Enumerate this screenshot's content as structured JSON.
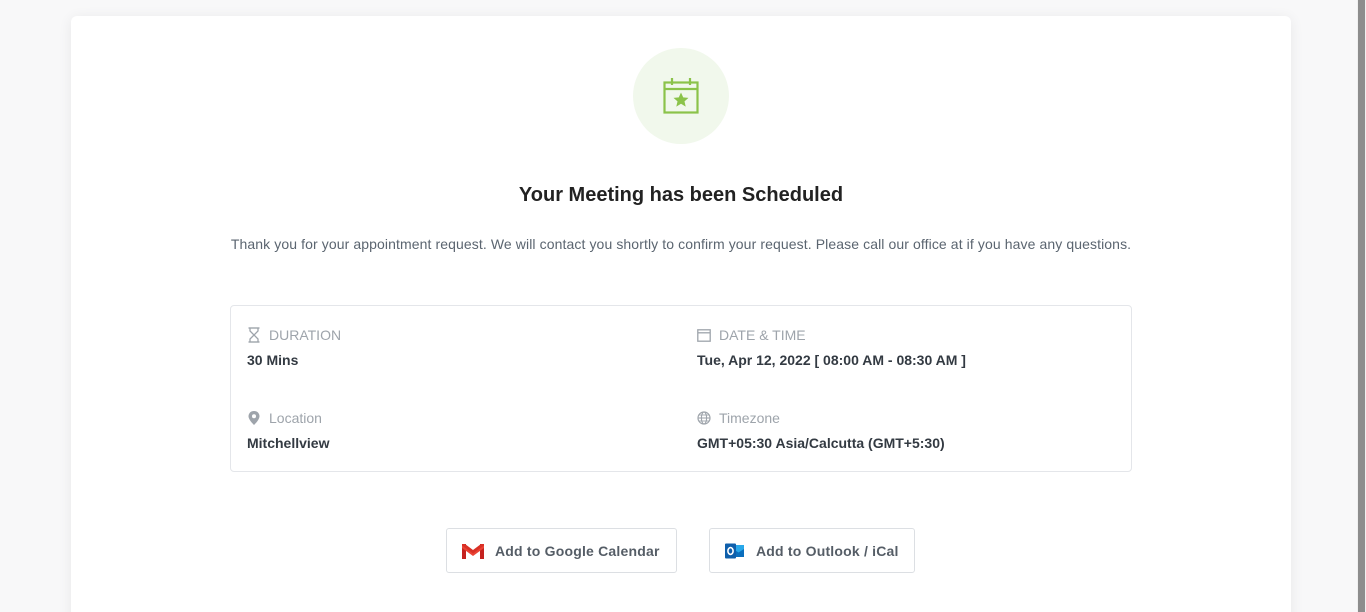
{
  "confirmation": {
    "icon": "calendar-star-icon",
    "title": "Your Meeting has been Scheduled",
    "message": "Thank you for your appointment request. We will contact you shortly to confirm your request. Please call our office at if you have any questions."
  },
  "details": {
    "duration": {
      "icon": "hourglass-icon",
      "label": "DURATION",
      "value": "30 Mins"
    },
    "datetime": {
      "icon": "calendar-icon",
      "label": "DATE & TIME",
      "value": "Tue, Apr 12, 2022 [ 08:00 AM - 08:30 AM ]"
    },
    "location": {
      "icon": "map-pin-icon",
      "label": "Location",
      "value": "Mitchellview"
    },
    "timezone": {
      "icon": "globe-icon",
      "label": "Timezone",
      "value": "GMT+05:30 Asia/Calcutta (GMT+5:30)"
    }
  },
  "actions": {
    "google": {
      "icon": "gmail-icon",
      "label": "Add to Google Calendar"
    },
    "outlook": {
      "icon": "outlook-icon",
      "label": "Add to Outlook / iCal"
    }
  },
  "colors": {
    "accent_green": "#8bc34a",
    "icon_circle_bg": "#f1f8ec",
    "gmail_red": "#ea4335",
    "outlook_blue": "#0a6ebd"
  }
}
